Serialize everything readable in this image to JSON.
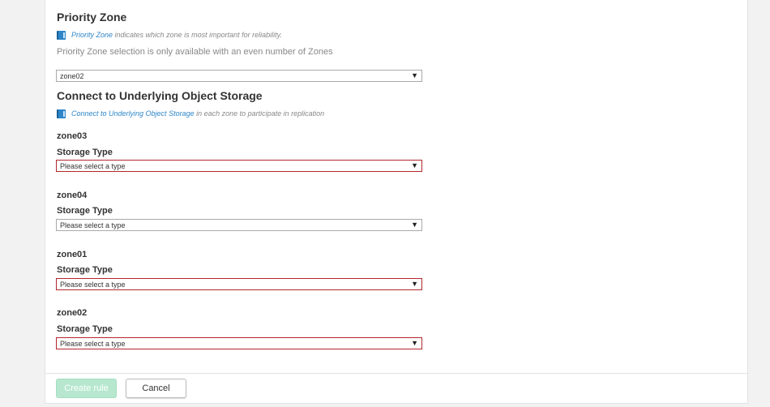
{
  "priority_zone": {
    "title": "Priority Zone",
    "info_link": "Priority Zone",
    "info_text": " indicates which zone is most important for reliability.",
    "note": "Priority Zone selection is only available with an even number of Zones",
    "selected": "zone02"
  },
  "underlying_storage": {
    "title": "Connect to Underlying Object Storage",
    "info_link": "Connect to Underlying Object Storage",
    "info_text": " in each zone to participate in replication",
    "field_label": "Storage Type",
    "zones": [
      {
        "name": "zone03",
        "label": "Storage Type",
        "value": "Please select a type"
      },
      {
        "name": "zone04",
        "label": "Storage Type",
        "value": "Please select a type"
      },
      {
        "name": "zone01",
        "label": "Storage Type",
        "value": "Please select a type"
      },
      {
        "name": "zone02",
        "label": "Storage Type",
        "value": "Please select a type"
      }
    ]
  },
  "footer": {
    "create_label": "Create rule",
    "cancel_label": "Cancel"
  },
  "icons": {
    "info": "book-icon",
    "dropdown": "triangle-down-icon"
  },
  "colors": {
    "link": "#2e86c9",
    "invalid_border": "#b3272d",
    "create_button_disabled": "#b7e8cf"
  }
}
